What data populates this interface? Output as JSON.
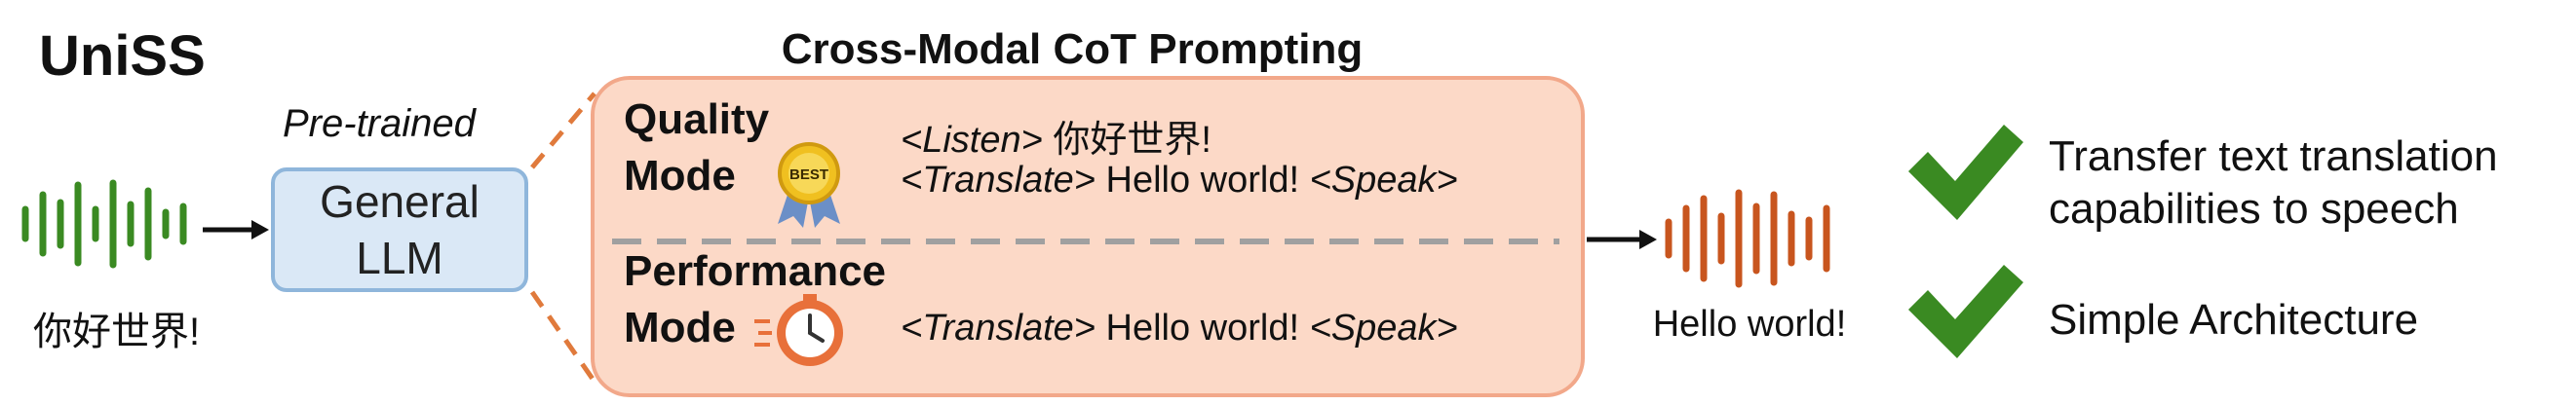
{
  "diagram": {
    "title": "UniSS",
    "input": {
      "text": "你好世界!"
    },
    "llm": {
      "caption": "Pre-trained",
      "line1": "General",
      "line2": "LLM"
    },
    "cot": {
      "title": "Cross-Modal CoT Prompting",
      "quality_mode": {
        "label_line1": "Quality",
        "label_line2": "Mode",
        "badge_icon": "best-badge-icon",
        "badge_text": "BEST",
        "prompt1": {
          "tag": "<Listen>",
          "text": " 你好世界!"
        },
        "prompt2": {
          "tag1": "<Translate>",
          "text": " Hello world! ",
          "tag2": "<Speak>"
        }
      },
      "performance_mode": {
        "label_line1": "Performance",
        "label_line2": "Mode",
        "badge_icon": "stopwatch-icon",
        "prompt": {
          "tag1": "<Translate>",
          "text": " Hello world! ",
          "tag2": "<Speak>"
        }
      }
    },
    "output": {
      "text": "Hello world!"
    },
    "benefits": [
      {
        "icon": "checkmark-icon",
        "line1": "Transfer text translation",
        "line2": "capabilities to speech"
      },
      {
        "icon": "checkmark-icon",
        "line1": "Simple Architecture"
      }
    ],
    "colors": {
      "input_wave": "#3a8a22",
      "output_wave": "#c8551e",
      "llm_fill": "#dae8f6",
      "llm_border": "#8fb6db",
      "cot_fill": "#fcd9c7",
      "cot_border": "#f2a88a",
      "dashed_divider": "#a0a0a0",
      "callout_dash": "#e07a3c",
      "checkmark": "#3a8a22",
      "badge_gold": "#f0c020",
      "ribbon": "#6b8fc7",
      "stopwatch": "#e8703a"
    }
  }
}
